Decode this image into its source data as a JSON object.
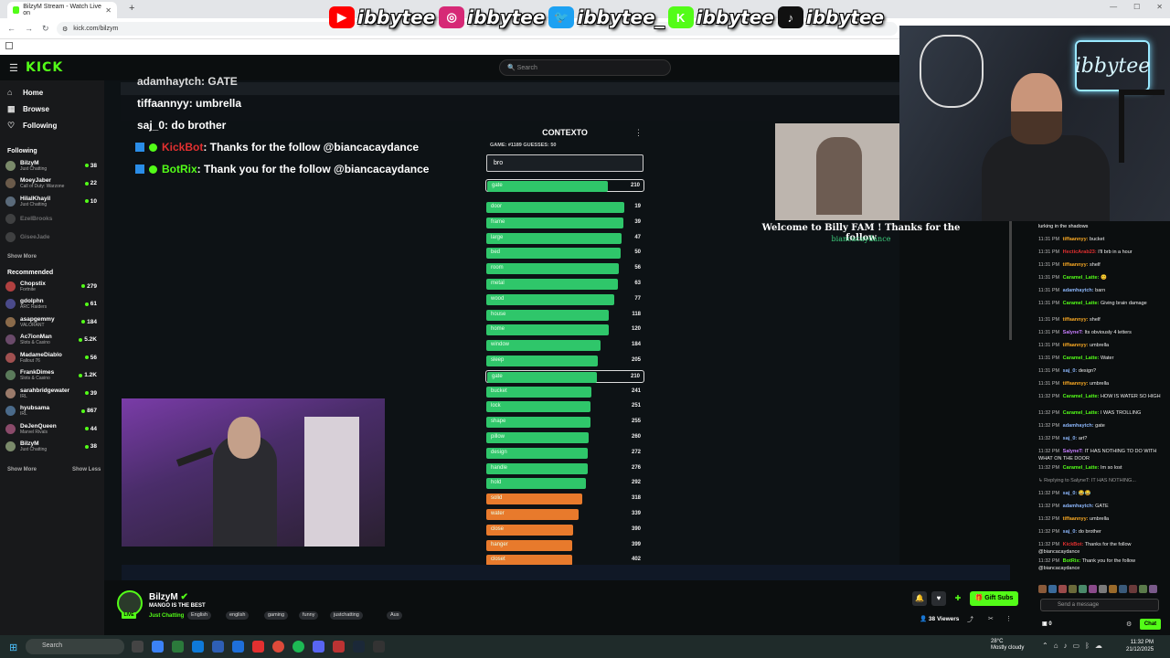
{
  "browser": {
    "tab_title": "BilzyM Stream - Watch Live on",
    "url": "kick.com/bilzym"
  },
  "socials": [
    {
      "icon": "youtube-icon",
      "color": "#ff0000",
      "handle": "ibbytee"
    },
    {
      "icon": "instagram-icon",
      "color": "#d62976",
      "handle": "ibbytee"
    },
    {
      "icon": "twitter-icon",
      "color": "#1da1f2",
      "handle": "ibbytee_"
    },
    {
      "icon": "kick-icon",
      "color": "#53fc18",
      "handle": "ibbytee"
    },
    {
      "icon": "tiktok-icon",
      "color": "#111111",
      "handle": "ibbytee"
    }
  ],
  "header": {
    "logo": "KICK",
    "search_placeholder": "Search"
  },
  "nav": [
    {
      "label": "Home",
      "icon": "home-icon"
    },
    {
      "label": "Browse",
      "icon": "browse-icon"
    },
    {
      "label": "Following",
      "icon": "heart-icon"
    }
  ],
  "following_heading": "Following",
  "following": [
    {
      "name": "BilzyM",
      "category": "Just Chatting",
      "viewers": "38",
      "color": "#7a8a6a",
      "offline": false
    },
    {
      "name": "MoeyJaber",
      "category": "Call of Duty: Warzone",
      "viewers": "22",
      "color": "#6a5a4a",
      "offline": false
    },
    {
      "name": "HilalKhayil",
      "category": "Just Chatting",
      "viewers": "10",
      "color": "#5a6a7a",
      "offline": false
    },
    {
      "name": "EzelBrooks",
      "category": "",
      "viewers": "",
      "color": "#888888",
      "offline": true
    },
    {
      "name": "GiseeJade",
      "category": "",
      "viewers": "",
      "color": "#888888",
      "offline": true
    }
  ],
  "show_more": "Show More",
  "recommended_heading": "Recommended",
  "recommended": [
    {
      "name": "Chopstix",
      "category": "Fortnite",
      "viewers": "279",
      "color": "#b04040"
    },
    {
      "name": "gdolphn",
      "category": "ARC Raiders",
      "viewers": "61",
      "color": "#4a4a8a"
    },
    {
      "name": "asapgemmy",
      "category": "VALORANT",
      "viewers": "184",
      "color": "#8a6a4a"
    },
    {
      "name": "Ac7ionMan",
      "category": "Slots & Casino",
      "viewers": "5.2K",
      "color": "#6a4a6a"
    },
    {
      "name": "MadameDiablo",
      "category": "Fallout 76",
      "viewers": "56",
      "color": "#a05050"
    },
    {
      "name": "FrankDimes",
      "category": "Slots & Casino",
      "viewers": "1.2K",
      "color": "#5a7a5a"
    },
    {
      "name": "sarahbridgewater",
      "category": "IRL",
      "viewers": "39",
      "color": "#9a7a6a"
    },
    {
      "name": "hyubsama",
      "category": "IRL",
      "viewers": "867",
      "color": "#4a6a8a"
    },
    {
      "name": "DeJenQueen",
      "category": "Marvel Rivals",
      "viewers": "44",
      "color": "#8a4a6a"
    },
    {
      "name": "BilzyM",
      "category": "Just Chatting",
      "viewers": "38",
      "color": "#7a8a6a"
    }
  ],
  "show_less": "Show Less",
  "overlay_chat": [
    {
      "user": "adamhaytch",
      "text": ": GATE"
    },
    {
      "user": "tiffaannyy",
      "text": ": umbrella"
    },
    {
      "user": "saj_0",
      "text": ": do brother"
    }
  ],
  "overlay_bots": [
    {
      "user": "KickBot",
      "user_color": "#e23030",
      "text": ": Thanks for the follow @biancacaydance"
    },
    {
      "user": "BotRix",
      "user_color": "#53fc18",
      "text": ": Thank you for the follow @biancacaydance"
    }
  ],
  "contexto": {
    "title": "CONTEXTO",
    "meta": "GAME: #1189   GUESSES: 50",
    "input": "bro",
    "top_guess": {
      "word": "gate",
      "rank": "210"
    },
    "guesses": [
      {
        "word": "door",
        "rank": "19",
        "fill": 0.97,
        "color": "#2fc66a"
      },
      {
        "word": "frame",
        "rank": "39",
        "fill": 0.96,
        "color": "#2fc66a"
      },
      {
        "word": "large",
        "rank": "47",
        "fill": 0.95,
        "color": "#2fc66a"
      },
      {
        "word": "bed",
        "rank": "50",
        "fill": 0.94,
        "color": "#2fc66a"
      },
      {
        "word": "room",
        "rank": "56",
        "fill": 0.93,
        "color": "#2fc66a"
      },
      {
        "word": "metal",
        "rank": "63",
        "fill": 0.92,
        "color": "#2fc66a"
      },
      {
        "word": "wood",
        "rank": "77",
        "fill": 0.9,
        "color": "#2fc66a"
      },
      {
        "word": "house",
        "rank": "118",
        "fill": 0.86,
        "color": "#2fc66a"
      },
      {
        "word": "home",
        "rank": "120",
        "fill": 0.86,
        "color": "#2fc66a"
      },
      {
        "word": "window",
        "rank": "184",
        "fill": 0.8,
        "color": "#2fc66a"
      },
      {
        "word": "sleep",
        "rank": "205",
        "fill": 0.78,
        "color": "#2fc66a"
      },
      {
        "word": "gate",
        "rank": "210",
        "fill": 0.77,
        "color": "#2fc66a",
        "selected": true
      },
      {
        "word": "bucket",
        "rank": "241",
        "fill": 0.74,
        "color": "#2fc66a"
      },
      {
        "word": "lock",
        "rank": "251",
        "fill": 0.73,
        "color": "#2fc66a"
      },
      {
        "word": "shape",
        "rank": "255",
        "fill": 0.73,
        "color": "#2fc66a"
      },
      {
        "word": "pillow",
        "rank": "260",
        "fill": 0.72,
        "color": "#2fc66a"
      },
      {
        "word": "design",
        "rank": "272",
        "fill": 0.71,
        "color": "#2fc66a"
      },
      {
        "word": "handle",
        "rank": "276",
        "fill": 0.71,
        "color": "#2fc66a"
      },
      {
        "word": "hold",
        "rank": "292",
        "fill": 0.7,
        "color": "#2fc66a"
      },
      {
        "word": "solid",
        "rank": "318",
        "fill": 0.67,
        "color": "#e87a2c"
      },
      {
        "word": "water",
        "rank": "339",
        "fill": 0.65,
        "color": "#e87a2c"
      },
      {
        "word": "close",
        "rank": "390",
        "fill": 0.61,
        "color": "#e87a2c"
      },
      {
        "word": "hanger",
        "rank": "399",
        "fill": 0.6,
        "color": "#e87a2c"
      },
      {
        "word": "closet",
        "rank": "402",
        "fill": 0.6,
        "color": "#e87a2c"
      }
    ]
  },
  "welcome": {
    "text": "Welcome to Billy FAM ! Thanks for the follow",
    "name": "biancacaydance"
  },
  "webcam_logo": "ibbytee",
  "chat": {
    "messages": [
      {
        "time": "",
        "user": "",
        "user_color": "#ffffff",
        "text": "lurking in the shadows"
      },
      {
        "time": "11:31 PM",
        "user": "tiffaannyy:",
        "user_color": "#f5a623",
        "text": "bucket"
      },
      {
        "time": "11:31 PM",
        "user": "HecticArab23:",
        "user_color": "#e23030",
        "text": "I'll brb in a hour"
      },
      {
        "time": "11:31 PM",
        "user": "tiffaannyy:",
        "user_color": "#f5a623",
        "text": "shelf"
      },
      {
        "time": "11:31 PM",
        "user": "Caramel_Latte:",
        "user_color": "#53fc18",
        "text": "😊"
      },
      {
        "time": "11:31 PM",
        "user": "adamhaytch:",
        "user_color": "#8ab4f8",
        "text": "barn"
      },
      {
        "time": "11:31 PM",
        "user": "Caramel_Latte:",
        "user_color": "#53fc18",
        "text": "Giving brain damage"
      },
      {
        "time": "11:31 PM",
        "user": "tiffaannyy:",
        "user_color": "#f5a623",
        "text": "shelf"
      },
      {
        "time": "11:31 PM",
        "user": "SalyneT:",
        "user_color": "#c77dff",
        "text": "Its obviously 4 letters"
      },
      {
        "time": "11:31 PM",
        "user": "tiffaannyy:",
        "user_color": "#f5a623",
        "text": "umbrella"
      },
      {
        "time": "11:31 PM",
        "user": "Caramel_Latte:",
        "user_color": "#53fc18",
        "text": "Water"
      },
      {
        "time": "11:31 PM",
        "user": "saj_0:",
        "user_color": "#8ab4f8",
        "text": "design?"
      },
      {
        "time": "11:31 PM",
        "user": "tiffaannyy:",
        "user_color": "#f5a623",
        "text": "umbrella"
      },
      {
        "time": "11:32 PM",
        "user": "Caramel_Latte:",
        "user_color": "#53fc18",
        "text": "HOW IS WATER SO HIGH"
      },
      {
        "time": "11:32 PM",
        "user": "Caramel_Latte:",
        "user_color": "#53fc18",
        "text": "I WAS TROLLING"
      },
      {
        "time": "11:32 PM",
        "user": "adamhaytch:",
        "user_color": "#8ab4f8",
        "text": "gate"
      },
      {
        "time": "11:32 PM",
        "user": "saj_0:",
        "user_color": "#8ab4f8",
        "text": "art?"
      },
      {
        "time": "11:32 PM",
        "user": "SalyneT:",
        "user_color": "#c77dff",
        "text": "IT HAS NOTHING TO DO WITH WHAT ON THE DOOR"
      },
      {
        "time": "11:32 PM",
        "user": "Caramel_Latte:",
        "user_color": "#53fc18",
        "text": "Im so lost"
      },
      {
        "time": "",
        "user": "",
        "user_color": "#999999",
        "text": "↳ Replying to SalyneT: IT HAS NOTHING..."
      },
      {
        "time": "11:32 PM",
        "user": "saj_0:",
        "user_color": "#8ab4f8",
        "text": "😂😂"
      },
      {
        "time": "11:32 PM",
        "user": "adamhaytch:",
        "user_color": "#8ab4f8",
        "text": "GATE"
      },
      {
        "time": "11:32 PM",
        "user": "tiffaannyy:",
        "user_color": "#f5a623",
        "text": "umbrella"
      },
      {
        "time": "11:32 PM",
        "user": "saj_0:",
        "user_color": "#8ab4f8",
        "text": "do brother"
      },
      {
        "time": "11:32 PM",
        "user": "KickBot:",
        "user_color": "#e23030",
        "text": "Thanks for the follow @biancacaydance"
      },
      {
        "time": "11:32 PM",
        "user": "BotRix:",
        "user_color": "#53fc18",
        "text": "Thank you for the follow @biancacaydance"
      }
    ],
    "send_placeholder": "Send a message",
    "chat_button": "Chat",
    "points": "0"
  },
  "channel": {
    "name": "BilzyM",
    "title": "MANGO IS THE BEST",
    "category": "Just Chatting",
    "live": "LIVE",
    "tags": [
      "English",
      "english",
      "gaming",
      "funny",
      "justchatting",
      "Aus"
    ],
    "gift_label": "Gift Subs",
    "viewers": "38 Viewers"
  },
  "taskbar": {
    "search": "Search",
    "weather_temp": "28°C",
    "weather_desc": "Mostly cloudy",
    "time": "11:32 PM",
    "date": "21/12/2025"
  }
}
